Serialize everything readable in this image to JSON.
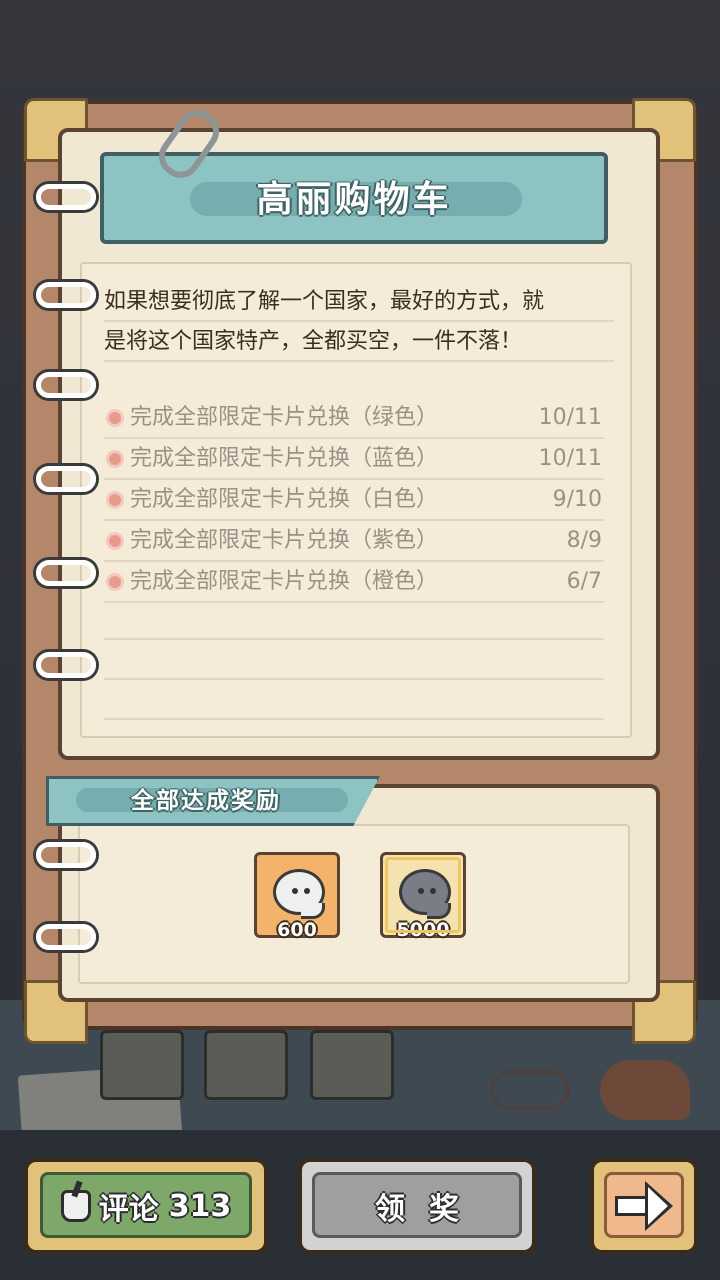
{
  "card": {
    "title": "高丽购物车",
    "description_lines": [
      "如果想要彻底了解一个国家，最好的方式，就",
      "是将这个国家特产，全都买空，一件不落！"
    ]
  },
  "tasks": [
    {
      "label": "完成全部限定卡片兑换（绿色）",
      "progress": "10/11"
    },
    {
      "label": "完成全部限定卡片兑换（蓝色）",
      "progress": "10/11"
    },
    {
      "label": "完成全部限定卡片兑换（白色）",
      "progress": "9/10"
    },
    {
      "label": "完成全部限定卡片兑换（紫色）",
      "progress": "8/9"
    },
    {
      "label": "完成全部限定卡片兑换（橙色）",
      "progress": "6/7"
    }
  ],
  "rewards": {
    "title": "全部达成奖励",
    "items": [
      {
        "icon": "white-speech-bubble-icon",
        "amount": "600"
      },
      {
        "icon": "gray-speech-bubble-icon",
        "amount": "5000"
      }
    ]
  },
  "buttons": {
    "comment_label": "评论",
    "comment_count": "313",
    "claim_label": "领奖"
  },
  "colors": {
    "banner_teal": "#8dc3c3",
    "paper": "#f1e8d3",
    "binder_brown": "#b5876a",
    "task_dot": "#e59c8d"
  }
}
